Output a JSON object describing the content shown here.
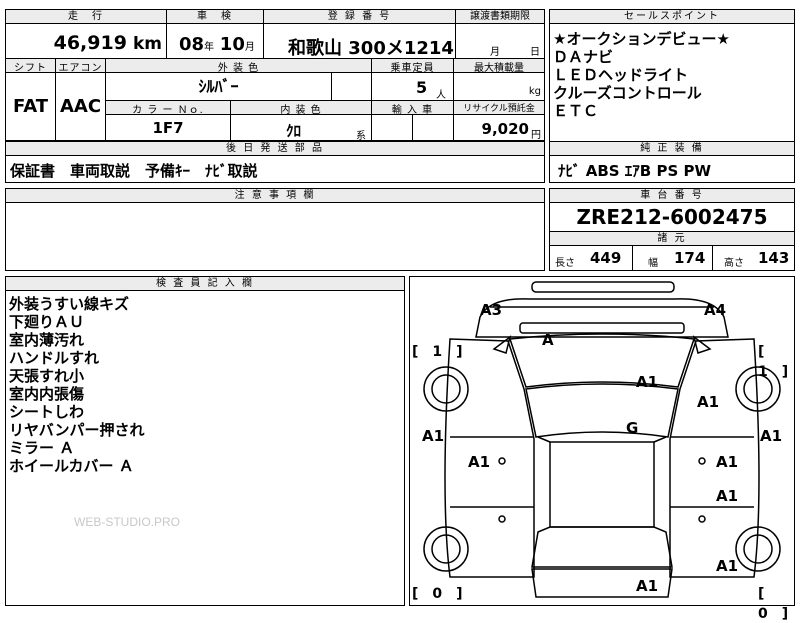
{
  "top": {
    "mileage_label": "走　行",
    "mileage_value": "46,919",
    "mileage_unit": "km",
    "inspection_label": "車　検",
    "inspection_year": "08",
    "inspection_year_unit": "年",
    "inspection_month": "10",
    "inspection_month_unit": "月",
    "registration_label": "登 録 番 号",
    "registration_value": "和歌山 300メ1214",
    "transfer_label": "譲渡書類期限",
    "transfer_month_unit": "月",
    "transfer_day_unit": "日"
  },
  "row2": {
    "shift_label": "シフト",
    "shift_value": "FAT",
    "ac_label": "エアコン",
    "ac_value": "AAC",
    "exterior_color_label": "外 装 色",
    "exterior_color_value": "ｼﾙﾊﾞｰ",
    "capacity_label": "乗車定員",
    "capacity_value": "5",
    "capacity_unit": "人",
    "max_load_label": "最大積載量",
    "max_load_unit": "kg",
    "color_no_label": "カ ラ ー Ｎｏ.",
    "color_no_value": "1F7",
    "interior_color_label": "内 装 色",
    "interior_color_value": "ｸﾛ",
    "interior_color_unit": "系",
    "import_label": "輸 入 車",
    "recycle_label": "リサイクル預託金",
    "recycle_value": "9,020",
    "recycle_unit": "円"
  },
  "later_parts": {
    "label": "後 日 発 送 部 品",
    "value": "保証書　車両取説　予備ｷｰ　ﾅﾋﾞ取説"
  },
  "notes": {
    "label": "注 意 事 項 欄"
  },
  "sales_points": {
    "label": "セールスポイント",
    "items": [
      "★オークションデビュー★",
      "ＤＡナビ",
      "ＬＥＤヘッドライト",
      "クルーズコントロール",
      "ＥＴＣ"
    ]
  },
  "genuine_equipment": {
    "label": "純 正 装 備",
    "value": "ﾅﾋﾞ ABS ｴｱB PS PW"
  },
  "chassis": {
    "label": "車 台 番 号",
    "value": "ZRE212-6002475"
  },
  "specs": {
    "label": "諸 元",
    "length_label": "長さ",
    "length_value": "449",
    "width_label": "幅",
    "width_value": "174",
    "height_label": "高さ",
    "height_value": "143"
  },
  "inspector": {
    "label": "検 査 員 記 入 欄",
    "items": [
      "外装うすい線キズ",
      "下廻りＡＵ",
      "室内薄汚れ",
      "ハンドルすれ",
      "天張すれ小",
      "室内内張傷",
      "シートしわ",
      "リヤバンパー押され",
      "ミラー Ａ",
      "ホイールカバー Ａ"
    ],
    "watermark": "WEB-STUDIO.PRO"
  },
  "diagram": {
    "marks": [
      "A3",
      "A4",
      "A",
      "A1",
      "A1",
      "G",
      "A1",
      "A1",
      "A1",
      "A1",
      "A1",
      "A1",
      "A1"
    ],
    "brackets": [
      "[　1　]",
      "[　1　]",
      "[　0　]",
      "[　0　]"
    ]
  }
}
